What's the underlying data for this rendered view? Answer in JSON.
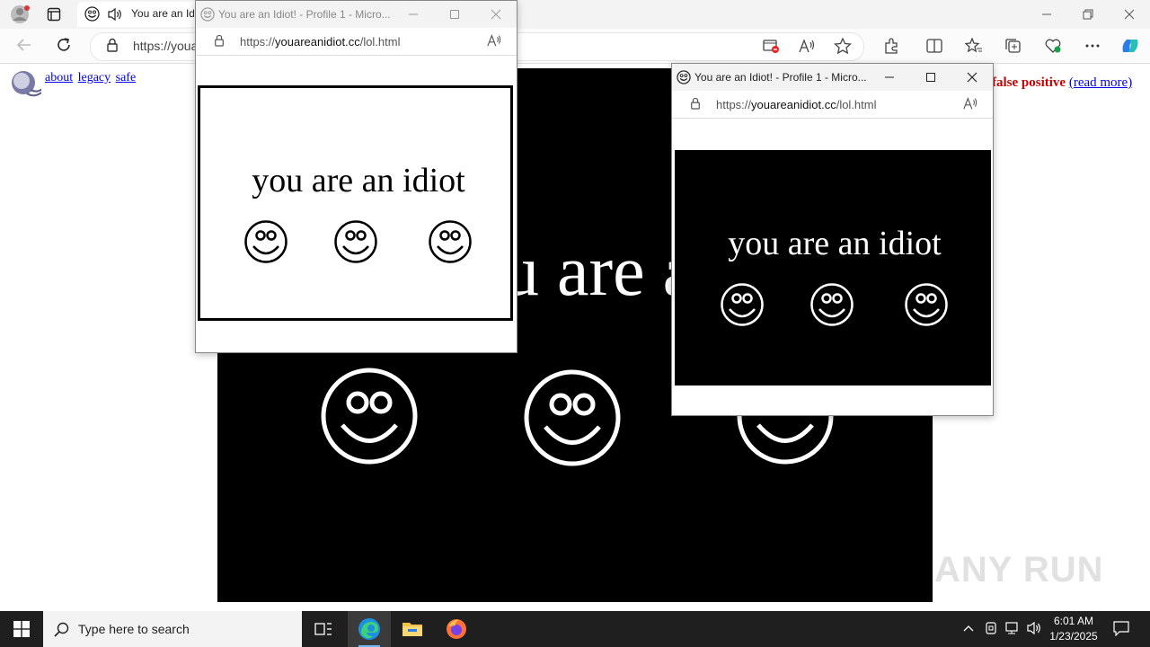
{
  "browser": {
    "tab_title": "You are an Idiot! - Profile 1 - Microsoft Edge",
    "url": "https://youareanidiot.cc/lol.html"
  },
  "page": {
    "links": [
      "about",
      "legacy",
      "safe"
    ],
    "false_positive": "false positive",
    "read_more": "(read more)",
    "big_text": "you are an idiot"
  },
  "popups": [
    {
      "title": "You are an Idiot! - Profile 1 - Micro...",
      "url_prefix": "https://",
      "url_domain": "youareanidiot.cc",
      "url_path": "/lol.html",
      "text": "you are an idiot",
      "theme": "white"
    },
    {
      "title": "You are an Idiot! - Profile 1 - Micro...",
      "url_prefix": "https://",
      "url_domain": "youareanidiot.cc",
      "url_path": "/lol.html",
      "text": "you are an idiot",
      "theme": "black"
    }
  ],
  "taskbar": {
    "search_placeholder": "Type here to search",
    "time": "6:01 AM",
    "date": "1/23/2025"
  },
  "watermark": "ANY RUN",
  "colors": {
    "accent_red": "#cc0000",
    "link": "#0000ee",
    "taskbar": "#1f1f1f"
  }
}
